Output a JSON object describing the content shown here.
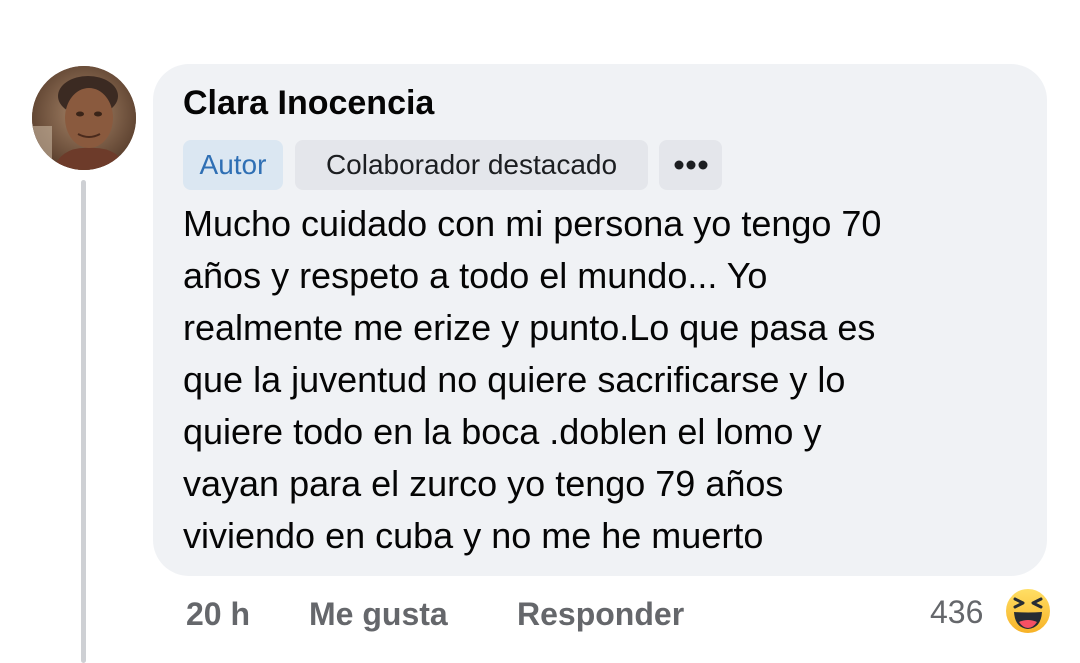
{
  "comment": {
    "author": "Clara Inocencia",
    "badges": {
      "author_badge": "Autor",
      "top_contributor_badge": "Colaborador destacado"
    },
    "more_icon": "more-horizontal-icon",
    "text_lines": [
      "Mucho cuidado con mi persona yo tengo 70",
      "años y respeto a todo el mundo... Yo",
      "realmente me erize y punto.Lo que pasa es",
      "que la juventud no quiere sacrificarse y lo",
      "quiere todo en la boca .doblen el lomo y",
      "vayan para el zurco yo tengo 79 años",
      "viviendo en cuba y no me he muerto"
    ]
  },
  "actions": {
    "time": "20 h",
    "like_label": "Me gusta",
    "reply_label": "Responder"
  },
  "reactions": {
    "count": "436",
    "icon": "haha-laughing-emoji-icon"
  },
  "colors": {
    "bubble": "#f0f2f5",
    "author_badge_bg": "#dbe7f2",
    "author_badge_text": "#2f6fb4",
    "secondary_text": "#65676b",
    "thread_line": "#ced0d4"
  }
}
